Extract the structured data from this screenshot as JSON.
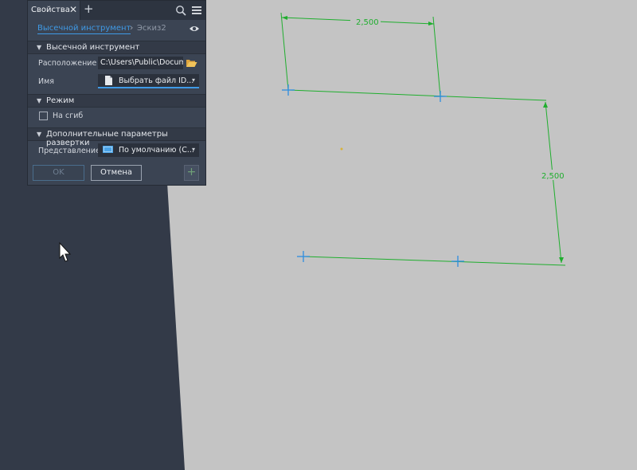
{
  "panel": {
    "tab_title": "Свойства",
    "tab_close_glyph": "✕",
    "tab_add_glyph": "+",
    "search_icon": "search-icon",
    "menu_icon": "hamburger-menu-icon",
    "breadcrumb": {
      "main": "Высечной инструмент",
      "separator": "›",
      "sub": "Эскиз2",
      "visibility_icon": "eye-icon"
    },
    "sections": [
      {
        "label": "Высечной инструмент",
        "toggle": "▼"
      },
      {
        "label": "Режим",
        "toggle": "▼"
      },
      {
        "label": "Дополнительные параметры развертки",
        "toggle": "▼"
      }
    ],
    "location": {
      "label": "Расположение",
      "value": "C:\\Users\\Public\\Documer",
      "icon": "folder-open-icon"
    },
    "name": {
      "label": "Имя",
      "value": "Выбрать файл ID...",
      "icon": "file-icon",
      "caret": "▾"
    },
    "on_bend": {
      "label": "На сгиб",
      "checked": false
    },
    "representation": {
      "label": "Представление",
      "value": "По умолчанию (С...",
      "icon": "view-representation-icon",
      "caret": "▾"
    },
    "buttons": {
      "ok": "OK",
      "cancel": "Отмена",
      "apply_glyph": "+"
    }
  },
  "sketch": {
    "dimension_top": "2,500",
    "dimension_right": "2,500",
    "line_color": "#1fae2e",
    "point_color": "#2d8ee0"
  }
}
